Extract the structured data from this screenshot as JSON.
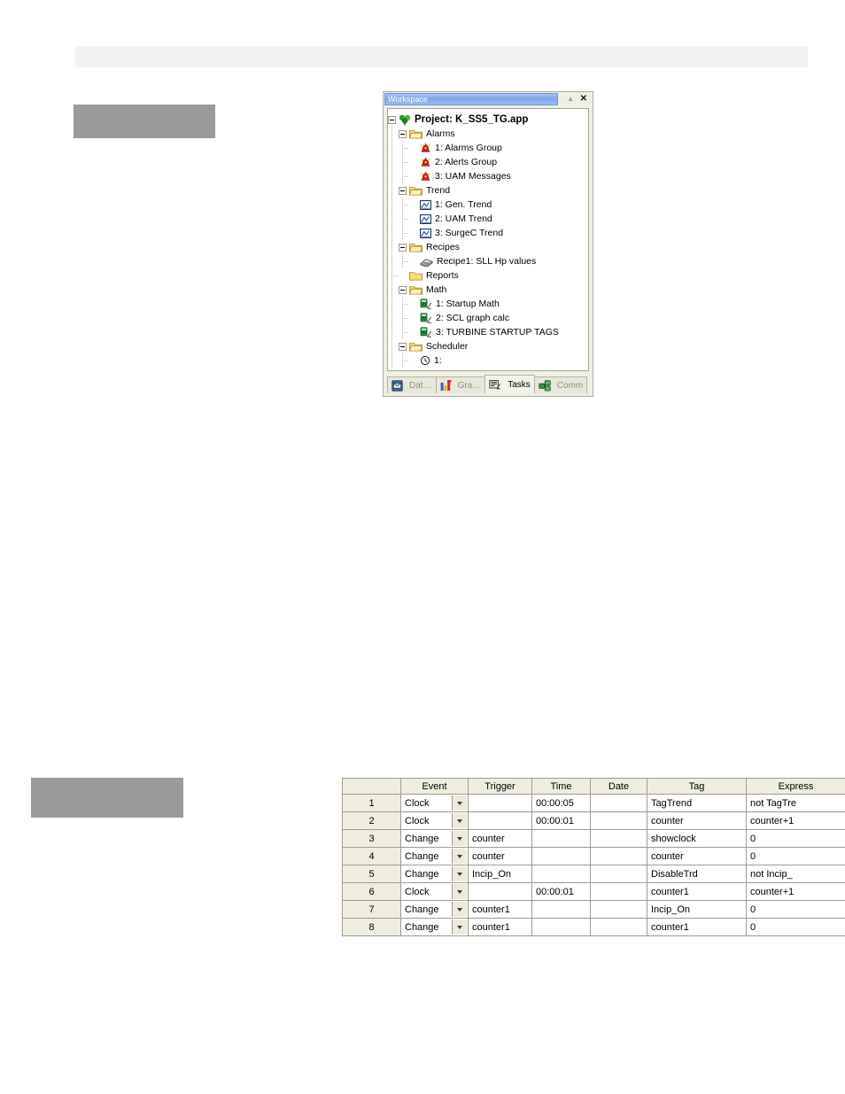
{
  "page": {
    "header_band_label": ""
  },
  "caption_boxes": [
    {
      "name": "caption-placeholder-top",
      "text": ""
    },
    {
      "name": "caption-placeholder-bottom",
      "text": ""
    }
  ],
  "workspace": {
    "title": "Workspace",
    "pin_icon": "pin-icon",
    "close_icon": "close-icon",
    "tree": [
      {
        "level": 0,
        "expander": "minus",
        "icon": "project-icon",
        "label": "Project: K_SS5_TG.app",
        "bold": true
      },
      {
        "level": 1,
        "expander": "minus",
        "icon": "folder-open-icon",
        "label": "Alarms",
        "bold": false
      },
      {
        "level": 2,
        "expander": "none",
        "icon": "alarm-bell-icon",
        "label": "1: Alarms Group",
        "bold": false
      },
      {
        "level": 2,
        "expander": "none",
        "icon": "alarm-bell-icon",
        "label": "2: Alerts Group",
        "bold": false
      },
      {
        "level": 2,
        "expander": "none",
        "icon": "alarm-bell-icon",
        "label": "3: UAM Messages",
        "bold": false
      },
      {
        "level": 1,
        "expander": "minus",
        "icon": "folder-open-icon",
        "label": "Trend",
        "bold": false
      },
      {
        "level": 2,
        "expander": "none",
        "icon": "trend-chart-icon",
        "label": "1: Gen. Trend",
        "bold": false
      },
      {
        "level": 2,
        "expander": "none",
        "icon": "trend-chart-icon",
        "label": "2: UAM Trend",
        "bold": false
      },
      {
        "level": 2,
        "expander": "none",
        "icon": "trend-chart-icon",
        "label": "3: SurgeC Trend",
        "bold": false
      },
      {
        "level": 1,
        "expander": "minus",
        "icon": "folder-open-icon",
        "label": "Recipes",
        "bold": false
      },
      {
        "level": 2,
        "expander": "none",
        "icon": "recipe-icon",
        "label": "Recipe1: SLL Hp values",
        "bold": false
      },
      {
        "level": 1,
        "expander": "none",
        "icon": "folder-closed-icon",
        "label": "Reports",
        "bold": false
      },
      {
        "level": 1,
        "expander": "minus",
        "icon": "folder-open-icon",
        "label": "Math",
        "bold": false
      },
      {
        "level": 2,
        "expander": "none",
        "icon": "math-script-icon",
        "label": "1: Startup Math",
        "bold": false
      },
      {
        "level": 2,
        "expander": "none",
        "icon": "math-script-icon",
        "label": "2: SCL graph calc",
        "bold": false
      },
      {
        "level": 2,
        "expander": "none",
        "icon": "math-script-icon",
        "label": "3: TURBINE STARTUP TAGS",
        "bold": false
      },
      {
        "level": 1,
        "expander": "minus",
        "icon": "folder-open-icon",
        "label": "Scheduler",
        "bold": false
      },
      {
        "level": 2,
        "expander": "none",
        "icon": "clock-icon",
        "label": "1:",
        "bold": false
      }
    ],
    "tabs": [
      {
        "label": "Dat…",
        "icon": "database-icon",
        "active": false
      },
      {
        "label": "Gra…",
        "icon": "graphics-icon",
        "active": false
      },
      {
        "label": "Tasks",
        "icon": "tasks-icon",
        "active": true
      },
      {
        "label": "Comm",
        "icon": "comm-icon",
        "active": false
      }
    ]
  },
  "task_table": {
    "columns": [
      "",
      "Event",
      "Trigger",
      "Time",
      "Date",
      "Tag",
      "Express"
    ],
    "rows": [
      {
        "num": "1",
        "event": "Clock",
        "trigger": "",
        "time": "00:00:05",
        "date": "",
        "tag": "TagTrend",
        "expression": "not TagTre"
      },
      {
        "num": "2",
        "event": "Clock",
        "trigger": "",
        "time": "00:00:01",
        "date": "",
        "tag": "counter",
        "expression": "counter+1"
      },
      {
        "num": "3",
        "event": "Change",
        "trigger": "counter",
        "time": "",
        "date": "",
        "tag": "showclock",
        "expression": "0"
      },
      {
        "num": "4",
        "event": "Change",
        "trigger": "counter",
        "time": "",
        "date": "",
        "tag": "counter",
        "expression": "0"
      },
      {
        "num": "5",
        "event": "Change",
        "trigger": "Incip_On",
        "time": "",
        "date": "",
        "tag": "DisableTrd",
        "expression": "not Incip_"
      },
      {
        "num": "6",
        "event": "Clock",
        "trigger": "",
        "time": "00:00:01",
        "date": "",
        "tag": "counter1",
        "expression": "counter+1"
      },
      {
        "num": "7",
        "event": "Change",
        "trigger": "counter1",
        "time": "",
        "date": "",
        "tag": "Incip_On",
        "expression": "0"
      },
      {
        "num": "8",
        "event": "Change",
        "trigger": "counter1",
        "time": "",
        "date": "",
        "tag": "counter1",
        "expression": "0"
      }
    ]
  },
  "colors": {
    "title_blue": "#7fa7e8",
    "header_band": "#f2f2f2",
    "gray_box": "#9a9a9a",
    "table_header": "#eeeddf",
    "folder_yellow": "#f7da72"
  }
}
